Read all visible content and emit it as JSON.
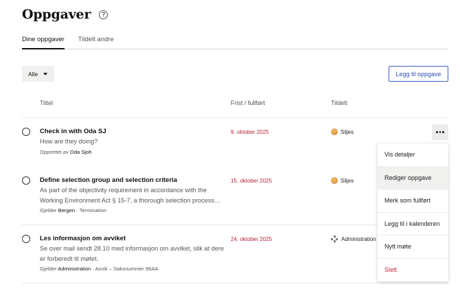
{
  "page": {
    "title": "Oppgaver",
    "help_glyph": "?"
  },
  "tabs": [
    {
      "label": "Dine oppgaver",
      "active": true
    },
    {
      "label": "Tildelt andre",
      "active": false
    }
  ],
  "filter": {
    "label": "Alle"
  },
  "add_button": {
    "label": "Legg til oppgave"
  },
  "columns": {
    "title": "Tittel",
    "due": "Frist / fullført",
    "assigned": "Tildelt"
  },
  "tasks": [
    {
      "title": "Check in with Oda SJ",
      "description": "How are they doing?",
      "meta_prefix": "Opprettet av ",
      "meta_bold": "Oda Sjoh",
      "meta_suffix": "",
      "due": "9. oktober 2025",
      "assignee": "Siljes",
      "assignee_icon": "avatar-icon"
    },
    {
      "title": "Define selection group and selection criteria",
      "description": "As part of the objectivity requirement in accordance with the Working Environment Act § 15-7, a thorough selection process…",
      "meta_prefix": "Gjelder ",
      "meta_bold": "Bergen",
      "meta_suffix": " · Termination",
      "due": "15. oktober 2025",
      "assignee": "Siljes",
      "assignee_icon": "avatar-icon"
    },
    {
      "title": "Les informasjon om avviket",
      "description": "Se over mail sendt 28.10 med informasjon om avviket, slik at dere er forberedt til møtet.",
      "meta_prefix": "Gjelder ",
      "meta_bold": "Administration",
      "meta_suffix": " · Avvik – Saksnummer 96AA",
      "due": "24. oktober 2025",
      "assignee": "Administration",
      "assignee_icon": "group-icon"
    }
  ],
  "context_menu": {
    "items": [
      "Vis detaljer",
      "Rediger oppgave",
      "Merk som fullført",
      "Legg til i kalenderen",
      "Nytt møte",
      "Slett"
    ],
    "hovered_index": 1,
    "danger_index": 5
  },
  "colors": {
    "accent": "#2f4fb2",
    "due_date": "#b5253a",
    "danger": "#c0283a"
  }
}
